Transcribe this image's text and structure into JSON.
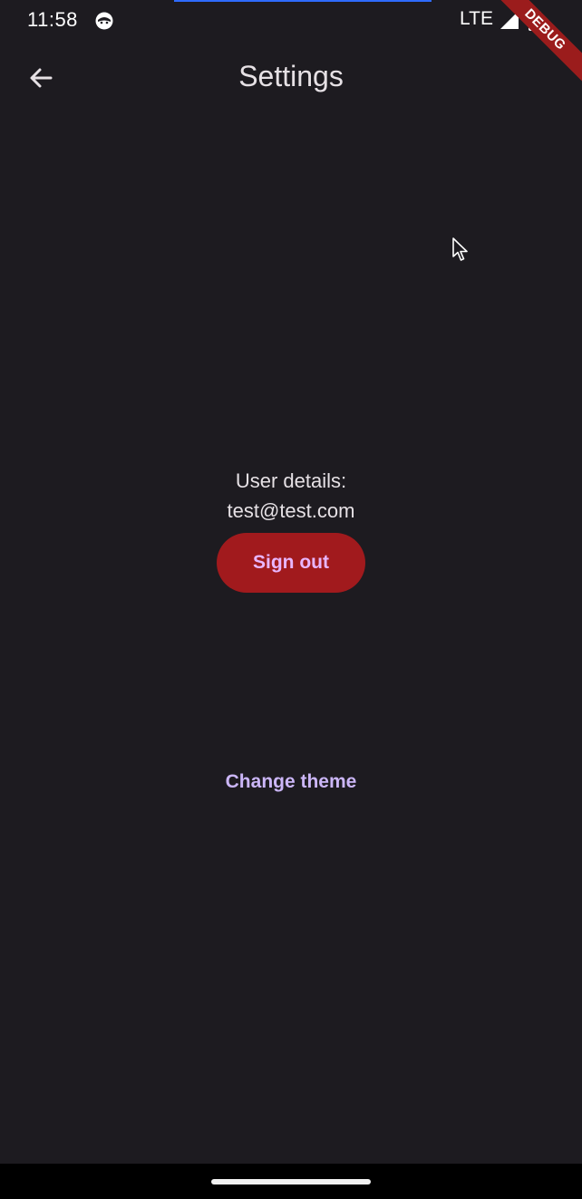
{
  "status_bar": {
    "time": "11:58",
    "network": "LTE",
    "icons": [
      "app-notification-icon",
      "signal-icon",
      "battery-icon"
    ]
  },
  "debug_banner": {
    "label": "DEBUG",
    "color": "#9b1c1c"
  },
  "app_bar": {
    "title": "Settings",
    "back_icon": "arrow-back-icon"
  },
  "content": {
    "user_details_label": "User details:",
    "user_email": "test@test.com",
    "sign_out_label": "Sign out",
    "change_theme_label": "Change theme"
  },
  "colors": {
    "background": "#1d1b20",
    "sign_out_bg": "#a11a1d",
    "sign_out_text": "#e8b6ff",
    "link_text": "#cbb6f7"
  }
}
